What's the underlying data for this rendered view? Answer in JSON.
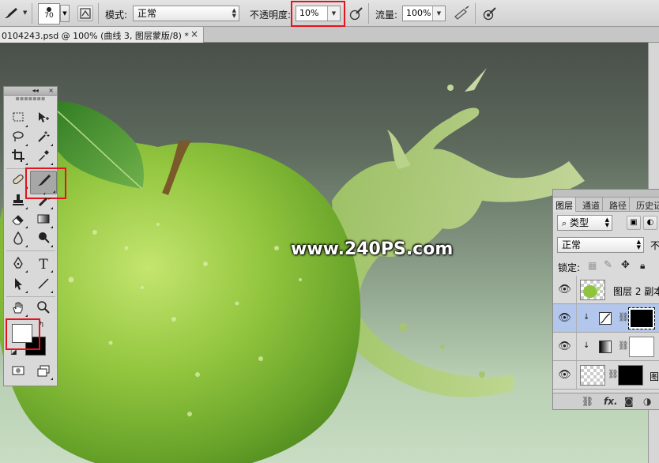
{
  "options_bar": {
    "brush_size": "70",
    "mode_label": "模式:",
    "mode_value": "正常",
    "opacity_label": "不透明度:",
    "opacity_value": "10%",
    "flow_label": "流量:",
    "flow_value": "100%"
  },
  "document_tab": {
    "title": "0104243.psd @ 100% (曲线 3, 图层蒙版/8) *",
    "close": "×"
  },
  "canvas": {
    "watermark": "www.240PS.com"
  },
  "tools_panel": {
    "collapse": "◂◂",
    "close": "×"
  },
  "layers_panel": {
    "tabs": [
      "图层",
      "通道",
      "路径",
      "历史记"
    ],
    "filter_kind": "类型",
    "blend_mode": "正常",
    "opacity_abbrev": "不",
    "lock_label": "锁定:",
    "layers": [
      {
        "name": "图层 2 副本",
        "selected": false
      },
      {
        "name": "",
        "selected": true
      },
      {
        "name": "",
        "selected": false
      },
      {
        "name": "图",
        "selected": false
      }
    ],
    "footer_fx": "fx."
  },
  "colors": {
    "highlight_red": "#e3141b",
    "selected_layer": "#b3c6eb",
    "apple_green": "#8fc43e"
  }
}
